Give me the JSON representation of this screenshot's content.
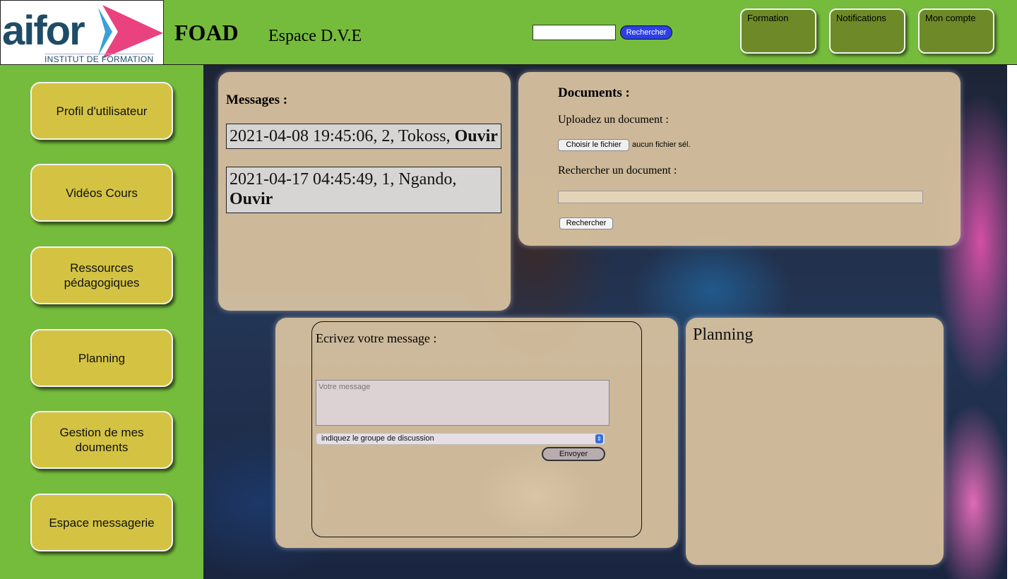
{
  "header": {
    "logo_text": "aifor",
    "logo_subtitle": "INSTITUT DE FORMATION",
    "brand": "FOAD",
    "space": "Espace D.V.E",
    "search_value": "",
    "search_button": "Rechercher",
    "nav": [
      "Formation",
      "Notifications",
      "Mon compte"
    ]
  },
  "sidebar": {
    "items": [
      "Profil d'utilisateur",
      "Vidéos Cours",
      "Ressources pédagogiques",
      "Planning",
      "Gestion de mes douments",
      "Espace messagerie"
    ]
  },
  "messages": {
    "title": "Messages :",
    "items": [
      {
        "date": "2021-04-08 19:45:06",
        "count": "2",
        "sender": "Tokoss",
        "action": "Ouvir"
      },
      {
        "date": "2021-04-17 04:45:49",
        "count": "1",
        "sender": "Ngando",
        "action": "Ouvir"
      }
    ]
  },
  "documents": {
    "title": "Documents :",
    "upload_label": "Uploadez un document :",
    "file_button": "Choisir le fichier",
    "file_status": "aucun fichier sél.",
    "search_label": "Rechercher un document :",
    "search_value": "",
    "search_button": "Rechercher"
  },
  "compose": {
    "title": "Ecrivez votre message :",
    "placeholder": "Votre message",
    "group_select": "indiquez le groupe de discussion",
    "send_button": "Envoyer"
  },
  "planning": {
    "title": "Planning"
  },
  "colors": {
    "background": "#76bc3c",
    "sidebar_button": "#d4c343",
    "nav_button": "#6e8a28",
    "search_button": "#2d3fe6",
    "panel": "#dac4a0"
  }
}
